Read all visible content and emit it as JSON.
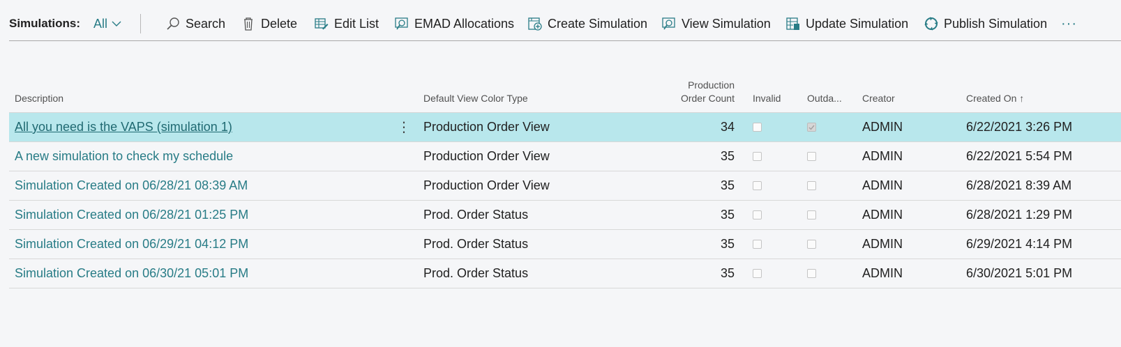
{
  "toolbar": {
    "title": "Simulations:",
    "filter_label": "All",
    "search_label": "Search",
    "delete_label": "Delete",
    "edit_list_label": "Edit List",
    "emad_label": "EMAD Allocations",
    "create_label": "Create Simulation",
    "view_label": "View Simulation",
    "update_label": "Update Simulation",
    "publish_label": "Publish Simulation",
    "more_label": "···"
  },
  "table": {
    "headers": {
      "description": "Description",
      "color_type": "Default View Color Type",
      "count_line1": "Production",
      "count_line2": "Order Count",
      "invalid": "Invalid",
      "outdated": "Outda...",
      "creator": "Creator",
      "created_on": "Created On",
      "sort_indicator": "↑"
    },
    "rows": [
      {
        "description": "All you need is the VAPS (simulation 1)",
        "color_type": "Production Order View",
        "count": "34",
        "invalid": false,
        "outdated": true,
        "creator": "ADMIN",
        "created_on": "6/22/2021 3:26 PM",
        "selected": true
      },
      {
        "description": "A new simulation to check my schedule",
        "color_type": "Production Order View",
        "count": "35",
        "invalid": false,
        "outdated": false,
        "creator": "ADMIN",
        "created_on": "6/22/2021 5:54 PM"
      },
      {
        "description": "Simulation Created on 06/28/21 08:39 AM",
        "color_type": "Production Order View",
        "count": "35",
        "invalid": false,
        "outdated": false,
        "creator": "ADMIN",
        "created_on": "6/28/2021 8:39 AM"
      },
      {
        "description": "Simulation Created on 06/28/21 01:25 PM",
        "color_type": "Prod. Order Status",
        "count": "35",
        "invalid": false,
        "outdated": false,
        "creator": "ADMIN",
        "created_on": "6/28/2021 1:29 PM"
      },
      {
        "description": "Simulation Created on 06/29/21 04:12 PM",
        "color_type": "Prod. Order Status",
        "count": "35",
        "invalid": false,
        "outdated": false,
        "creator": "ADMIN",
        "created_on": "6/29/2021 4:14 PM"
      },
      {
        "description": "Simulation Created on 06/30/21 05:01 PM",
        "color_type": "Prod. Order Status",
        "count": "35",
        "invalid": false,
        "outdated": false,
        "creator": "ADMIN",
        "created_on": "6/30/2021 5:01 PM"
      }
    ],
    "row_menu_glyph": "⋮"
  },
  "colors": {
    "accent": "#287c86",
    "selected_row": "#b8e7ec",
    "background": "#f5f6f8"
  },
  "icons": [
    "chevron-down-icon",
    "search-icon",
    "trash-icon",
    "edit-list-icon",
    "emad-icon",
    "create-simulation-icon",
    "view-simulation-icon",
    "update-simulation-icon",
    "publish-simulation-icon",
    "more-icon",
    "row-menu-icon"
  ]
}
